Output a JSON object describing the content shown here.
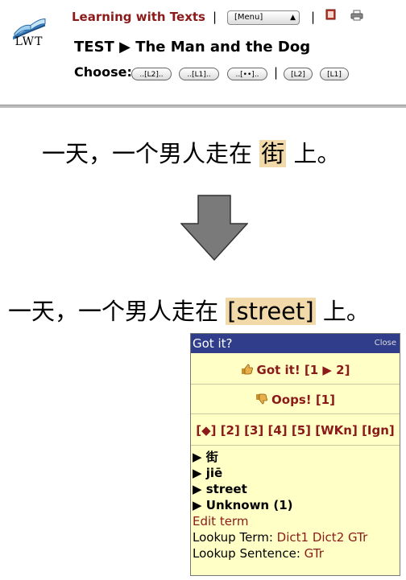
{
  "header": {
    "logo_text": "LWT",
    "app_title": "Learning with Texts",
    "separator": "|",
    "menu_value": "[Menu]",
    "text_title": "TEST ▶ The Man and the Dog",
    "choose_label": "Choose:",
    "choose_buttons": [
      "..[L2]..",
      "..[L1]..",
      "..[••]..",
      "[L2]",
      "[L1]"
    ]
  },
  "reader": {
    "sentence_before_pre": "一天，一个男人走在",
    "sentence_before_term": "街",
    "sentence_before_post": "上。",
    "sentence_after_pre": "一天，一个男人走在",
    "sentence_after_term": "[street]",
    "sentence_after_post": "上。"
  },
  "popup": {
    "title": "Got it?",
    "close": "Close",
    "got_it": "Got it! [1 ▶ 2]",
    "oops": "Oops! [1]",
    "status_buttons": [
      "[◆]",
      "[2]",
      "[3]",
      "[4]",
      "[5]",
      "[WKn]",
      "[Ign]"
    ],
    "term": "▶ 街",
    "romanization": "▶ jiē",
    "translation": "▶ street",
    "status": "▶ Unknown (1)",
    "edit_term": "Edit term",
    "lookup_term_label": "Lookup Term:",
    "lookup_term_links": [
      "Dict1",
      "Dict2",
      "GTr"
    ],
    "lookup_sentence_label": "Lookup Sentence:",
    "lookup_sentence_links": [
      "GTr"
    ]
  },
  "colors": {
    "accent_red": "#8b1a1a",
    "popup_header": "#2f3d8b",
    "popup_bg": "#ffffc6",
    "highlight": "#f1d9a9"
  },
  "icons": [
    "lwt-book-logo-icon",
    "book-icon",
    "print-icon",
    "down-arrow-icon",
    "thumbs-up-icon",
    "thumbs-down-icon"
  ]
}
